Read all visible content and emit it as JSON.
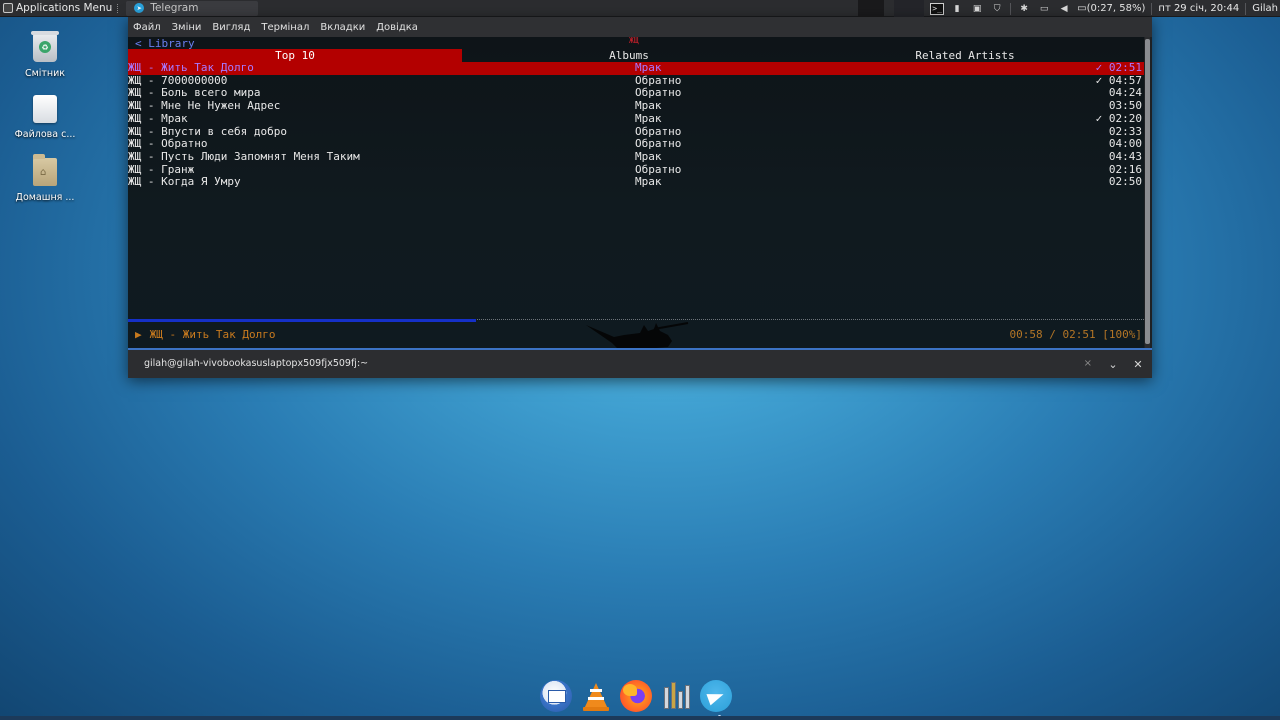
{
  "top_panel": {
    "apps_menu_label": "Applications Menu",
    "task_label": "Telegram",
    "battery": "(0:27, 58%)",
    "clock": "пт 29 січ, 20:44",
    "user": "Gilah",
    "term_glyph": ">_"
  },
  "desktop": {
    "icons": [
      {
        "label": "Смітник"
      },
      {
        "label": "Файлова с..."
      },
      {
        "label": "Домашня ..."
      }
    ]
  },
  "terminal": {
    "menu": [
      "Файл",
      "Зміни",
      "Вигляд",
      "Термінал",
      "Вкладки",
      "Довідка"
    ],
    "back_link": "< Library",
    "artist_mark": "ЖЩ",
    "tabs": [
      "Top 10",
      "Albums",
      "Related Artists"
    ],
    "active_tab": 0,
    "tracks": [
      {
        "title": "ЖЩ - Жить Так Долго",
        "album": "Мрак",
        "check": "✓",
        "duration": "02:51",
        "selected": true
      },
      {
        "title": "ЖЩ - 7000000000",
        "album": "Обратно",
        "check": "✓",
        "duration": "04:57"
      },
      {
        "title": "ЖЩ - Боль всего мира",
        "album": "Обратно",
        "check": "",
        "duration": "04:24"
      },
      {
        "title": "ЖЩ - Мне Не Нужен Адрес",
        "album": "Мрак",
        "check": "",
        "duration": "03:50"
      },
      {
        "title": "ЖЩ - Мрак",
        "album": "Мрак",
        "check": "✓",
        "duration": "02:20"
      },
      {
        "title": "ЖЩ - Впусти в себя добро",
        "album": "Обратно",
        "check": "",
        "duration": "02:33"
      },
      {
        "title": "ЖЩ - Обратно",
        "album": "Обратно",
        "check": "",
        "duration": "04:00"
      },
      {
        "title": "ЖЩ - Пусть Люди Запомнят Меня Таким",
        "album": "Мрак",
        "check": "",
        "duration": "04:43"
      },
      {
        "title": "ЖЩ - Гранж",
        "album": "Обратно",
        "check": "",
        "duration": "02:16"
      },
      {
        "title": "ЖЩ - Когда Я Умру",
        "album": "Мрак",
        "check": "",
        "duration": "02:50"
      }
    ],
    "playback": {
      "arrow": "▶",
      "now_playing": "ЖЩ - Жить Так Долго",
      "time": "00:58 / 02:51 [100%]",
      "progress_fraction": 0.343
    },
    "tab_title": "gilah@gilah-vivobookasuslaptopx509fjx509fj:~",
    "tab_close": "×",
    "collapse_glyph": "⌄",
    "prefs_glyph": "✕"
  },
  "colors": {
    "accent_red": "#b30000",
    "selected_text": "#a878ff",
    "now_playing": "#c87a1e",
    "progress": "#1530c8",
    "link_blue": "#6a7ff0"
  },
  "dock": {
    "icons": [
      "mail-client-icon",
      "vlc-icon",
      "firefox-icon",
      "system-tool-icon",
      "telegram-icon"
    ]
  }
}
